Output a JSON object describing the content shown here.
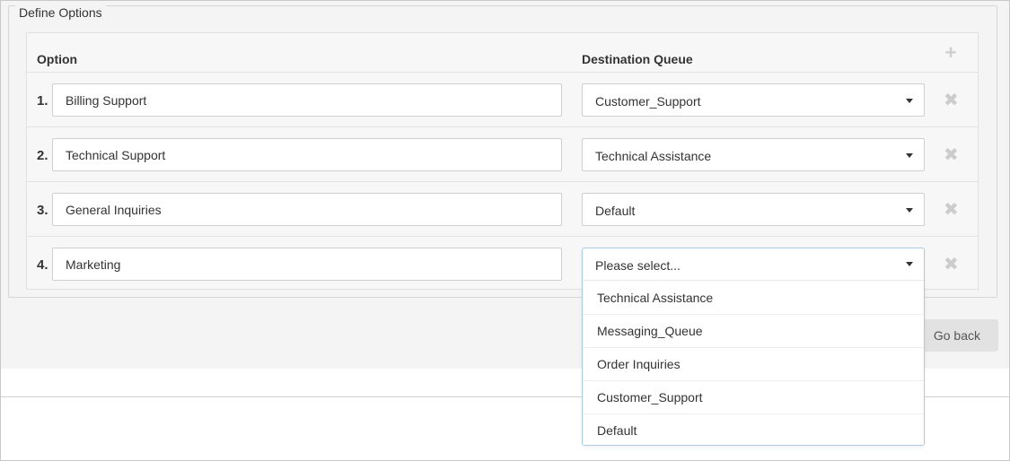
{
  "section": {
    "legend": "Define Options"
  },
  "table": {
    "headers": {
      "option": "Option",
      "destination": "Destination Queue"
    },
    "add_icon": "plus-icon",
    "remove_icon": "close-icon",
    "rows": [
      {
        "num": "1.",
        "option": "Billing Support",
        "queue": "Customer_Support"
      },
      {
        "num": "2.",
        "option": "Technical Support",
        "queue": "Technical Assistance"
      },
      {
        "num": "3.",
        "option": "General Inquiries",
        "queue": "Default"
      },
      {
        "num": "4.",
        "option": "Marketing",
        "queue": ""
      }
    ]
  },
  "dropdown": {
    "placeholder": "Please select...",
    "options": [
      "Technical Assistance",
      "Messaging_Queue",
      "Order Inquiries",
      "Customer_Support",
      "Default"
    ]
  },
  "actions": {
    "go_back": "Go back"
  },
  "colors": {
    "panel_bg": "#f4f4f4",
    "dropdown_border": "#a9cce3",
    "icon_muted": "#cccccc"
  }
}
